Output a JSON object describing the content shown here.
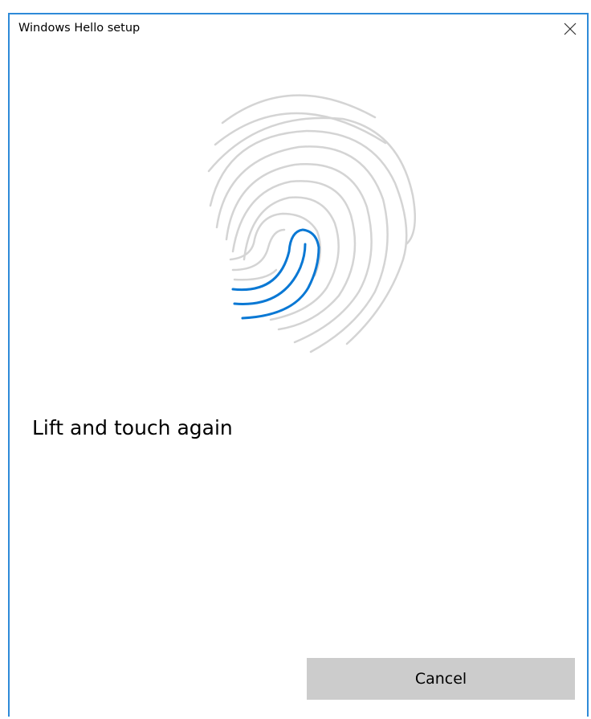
{
  "window": {
    "title": "Windows Hello setup",
    "border_color": "#2e8ad8"
  },
  "title_bar": {
    "close_icon": "close-icon"
  },
  "fingerprint": {
    "icon": "fingerprint-icon",
    "ridge_color": "#d4d4d4",
    "progress_color": "#0a78d4"
  },
  "status": {
    "message": "Lift and touch again"
  },
  "actions": {
    "cancel_label": "Cancel"
  }
}
